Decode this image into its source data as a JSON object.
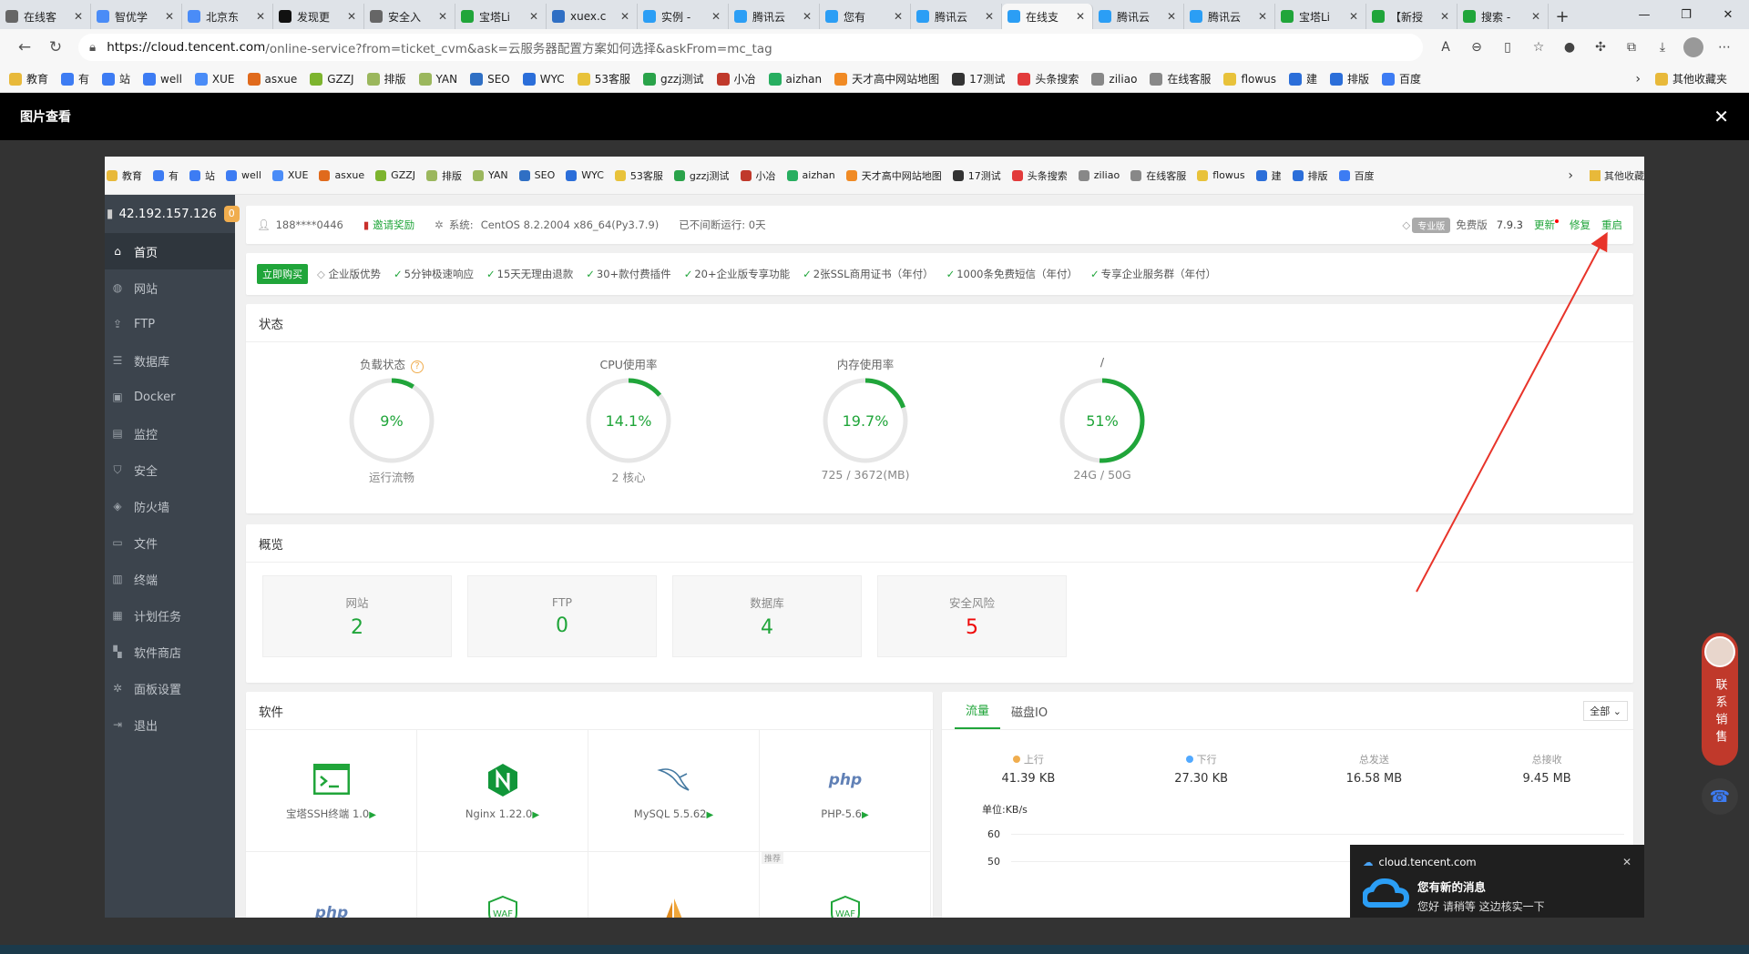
{
  "browser": {
    "tabs": [
      {
        "label": "在线客",
        "color": "#666",
        "active": false
      },
      {
        "label": "智优学",
        "color": "#4a8cf7",
        "active": false
      },
      {
        "label": "北京东",
        "color": "#4a8cf7",
        "active": false
      },
      {
        "label": "发现更",
        "color": "#111",
        "active": false
      },
      {
        "label": "安全入",
        "color": "#666",
        "active": false
      },
      {
        "label": "宝塔Li",
        "color": "#20a53a",
        "active": false
      },
      {
        "label": "xuex.c",
        "color": "#2f6fc4",
        "active": false
      },
      {
        "label": "实例 -",
        "color": "#2b9ef5",
        "active": false
      },
      {
        "label": "腾讯云",
        "color": "#2b9ef5",
        "active": false
      },
      {
        "label": "您有",
        "color": "#2b9ef5",
        "active": false
      },
      {
        "label": "腾讯云",
        "color": "#2b9ef5",
        "active": false
      },
      {
        "label": "在线支",
        "color": "#2b9ef5",
        "active": true
      },
      {
        "label": "腾讯云",
        "color": "#2b9ef5",
        "active": false
      },
      {
        "label": "腾讯云",
        "color": "#2b9ef5",
        "active": false
      },
      {
        "label": "宝塔Li",
        "color": "#20a53a",
        "active": false
      },
      {
        "label": "【新授",
        "color": "#20a53a",
        "active": false
      },
      {
        "label": "搜索 -",
        "color": "#20a53a",
        "active": false
      }
    ],
    "new_tab": "+",
    "url_host": "https://cloud.tencent.com",
    "url_path": "/online-service?from=ticket_cvm&ask=云服务器配置方案如何选择&askFrom=mc_tag",
    "bookmarks": [
      {
        "label": "教育",
        "color": "#e8b93a"
      },
      {
        "label": "有",
        "color": "#3d7cf3"
      },
      {
        "label": "站",
        "color": "#3d7cf3"
      },
      {
        "label": "well",
        "color": "#3d7cf3"
      },
      {
        "label": "XUE",
        "color": "#4a8cf7"
      },
      {
        "label": "asxue",
        "color": "#e06a1c"
      },
      {
        "label": "GZZJ",
        "color": "#7db42e"
      },
      {
        "label": "排版",
        "color": "#9bb75d"
      },
      {
        "label": "YAN",
        "color": "#9bb75d"
      },
      {
        "label": "SEO",
        "color": "#2f6fc4"
      },
      {
        "label": "WYC",
        "color": "#2b6ed9"
      },
      {
        "label": "53客服",
        "color": "#e8c23a"
      },
      {
        "label": "gzzj测试",
        "color": "#2aa34a"
      },
      {
        "label": "小冶",
        "color": "#c0392b"
      },
      {
        "label": "aizhan",
        "color": "#27ae60"
      },
      {
        "label": "天才高中网站地图",
        "color": "#f08a24"
      },
      {
        "label": "17测试",
        "color": "#333"
      },
      {
        "label": "头条搜索",
        "color": "#e23b3b"
      },
      {
        "label": "ziliao",
        "color": "#888"
      },
      {
        "label": "在线客服",
        "color": "#888"
      },
      {
        "label": "flowus",
        "color": "#e8c23a"
      },
      {
        "label": "建",
        "color": "#2b6ed9"
      },
      {
        "label": "排版",
        "color": "#2b6ed9"
      },
      {
        "label": "百度",
        "color": "#3d7cf3"
      }
    ],
    "other_bookmarks": "其他收藏夹"
  },
  "viewer": {
    "title": "图片查看",
    "close": "✕"
  },
  "shot_bookmarks": {
    "other": "其他收藏"
  },
  "panel": {
    "server_ip": "42.192.157.126",
    "badge": "0",
    "menu": [
      {
        "label": "首页",
        "icon": "home-icon",
        "glyph": "⌂",
        "active": true
      },
      {
        "label": "网站",
        "icon": "globe-icon",
        "glyph": "◍",
        "active": false
      },
      {
        "label": "FTP",
        "icon": "ftp-icon",
        "glyph": "⇪",
        "active": false
      },
      {
        "label": "数据库",
        "icon": "database-icon",
        "glyph": "☰",
        "active": false
      },
      {
        "label": "Docker",
        "icon": "docker-icon",
        "glyph": "▣",
        "active": false
      },
      {
        "label": "监控",
        "icon": "monitor-icon",
        "glyph": "▤",
        "active": false
      },
      {
        "label": "安全",
        "icon": "shield-icon",
        "glyph": "⛉",
        "active": false
      },
      {
        "label": "防火墙",
        "icon": "firewall-icon",
        "glyph": "◈",
        "active": false
      },
      {
        "label": "文件",
        "icon": "folder-icon",
        "glyph": "▭",
        "active": false
      },
      {
        "label": "终端",
        "icon": "terminal-icon",
        "glyph": "▥",
        "active": false
      },
      {
        "label": "计划任务",
        "icon": "calendar-icon",
        "glyph": "▦",
        "active": false
      },
      {
        "label": "软件商店",
        "icon": "apps-icon",
        "glyph": "▚",
        "active": false
      },
      {
        "label": "面板设置",
        "icon": "gear-icon",
        "glyph": "✲",
        "active": false
      },
      {
        "label": "退出",
        "icon": "logout-icon",
        "glyph": "⇥",
        "active": false
      }
    ],
    "info": {
      "user": "188****0446",
      "invite": "邀请奖励",
      "system_label": "系统:",
      "system": "CentOS 8.2.2004 x86_64(Py3.7.9)",
      "uptime": "已不间断运行: 0天",
      "pro_badge": "专业版",
      "edition": "免费版",
      "version": "7.9.3",
      "update": "更新",
      "repair": "修复",
      "restart": "重启"
    },
    "promo": {
      "buy": "立即购买",
      "enterprise": "企业版优势",
      "perks": [
        "5分钟极速响应",
        "15天无理由退款",
        "30+款付费插件",
        "20+企业版专享功能",
        "2张SSL商用证书（年付）",
        "1000条免费短信（年付）",
        "专享企业服务群（年付）"
      ]
    },
    "status": {
      "title": "状态",
      "gauges": [
        {
          "name": "负载状态",
          "value": "9%",
          "percent": 9,
          "sub": "运行流畅",
          "help": "?"
        },
        {
          "name": "CPU使用率",
          "value": "14.1%",
          "percent": 14.1,
          "sub": "2 核心"
        },
        {
          "name": "内存使用率",
          "value": "19.7%",
          "percent": 19.7,
          "sub": "725 / 3672(MB)"
        },
        {
          "name": "/",
          "value": "51%",
          "percent": 51,
          "sub": "24G / 50G"
        }
      ]
    },
    "overview": {
      "title": "概览",
      "stats": [
        {
          "name": "网站",
          "value": "2",
          "danger": false
        },
        {
          "name": "FTP",
          "value": "0",
          "danger": false
        },
        {
          "name": "数据库",
          "value": "4",
          "danger": false
        },
        {
          "name": "安全风险",
          "value": "5",
          "danger": true
        }
      ]
    },
    "software": {
      "title": "软件",
      "items": [
        {
          "label": "宝塔SSH终端 1.0",
          "icon": "terminal-app-icon"
        },
        {
          "label": "Nginx 1.22.0",
          "icon": "nginx-icon"
        },
        {
          "label": "MySQL 5.5.62",
          "icon": "mysql-icon"
        },
        {
          "label": "PHP-5.6",
          "icon": "php-icon"
        },
        {
          "label": "",
          "icon": "php-icon"
        },
        {
          "label": "",
          "icon": "waf-icon"
        },
        {
          "label": "",
          "icon": "sail-icon",
          "tag": ""
        },
        {
          "label": "",
          "icon": "waf-icon",
          "tag": "推荐"
        }
      ],
      "play": "▶"
    },
    "traffic": {
      "tabs": [
        "流量",
        "磁盘IO"
      ],
      "select": "全部",
      "stats": [
        {
          "name": "上行",
          "value": "41.39 KB",
          "dot": "#f0ad4e"
        },
        {
          "name": "下行",
          "value": "27.30 KB",
          "dot": "#52a9ff"
        },
        {
          "name": "总发送",
          "value": "16.58 MB",
          "dot": ""
        },
        {
          "name": "总接收",
          "value": "9.45 MB",
          "dot": ""
        }
      ],
      "unit": "单位:KB/s",
      "yticks": [
        "60",
        "50"
      ]
    }
  },
  "toast": {
    "site": "cloud.tencent.com",
    "close": "✕",
    "title": "您有新的消息",
    "message": "您好 请稍等 这边核实一下"
  },
  "float": {
    "contact": "联系销售"
  },
  "colors": {
    "accent": "#20a53a",
    "danger": "#ef0808",
    "sidebar": "#3c444d",
    "arrow": "#e8342a"
  }
}
